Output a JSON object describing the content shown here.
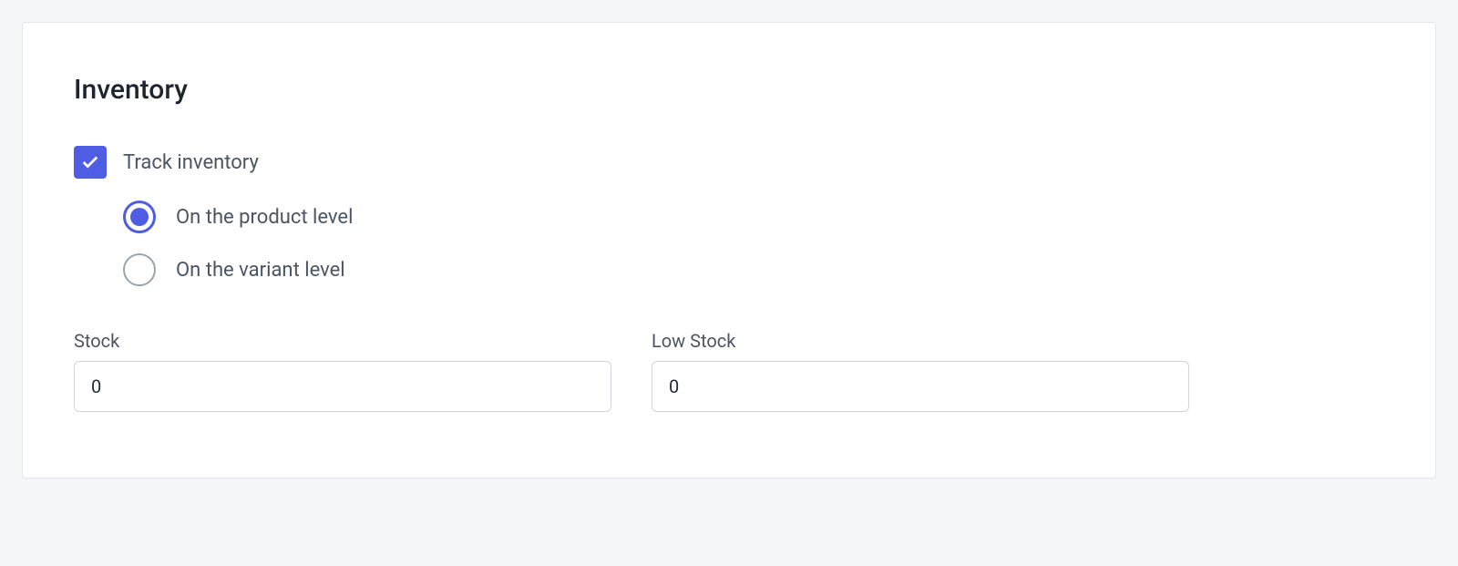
{
  "section": {
    "title": "Inventory"
  },
  "track_inventory": {
    "label": "Track inventory",
    "checked": true
  },
  "inventory_level": {
    "options": [
      {
        "label": "On the product level",
        "selected": true
      },
      {
        "label": "On the variant level",
        "selected": false
      }
    ]
  },
  "fields": {
    "stock": {
      "label": "Stock",
      "value": "0"
    },
    "low_stock": {
      "label": "Low Stock",
      "value": "0"
    }
  }
}
